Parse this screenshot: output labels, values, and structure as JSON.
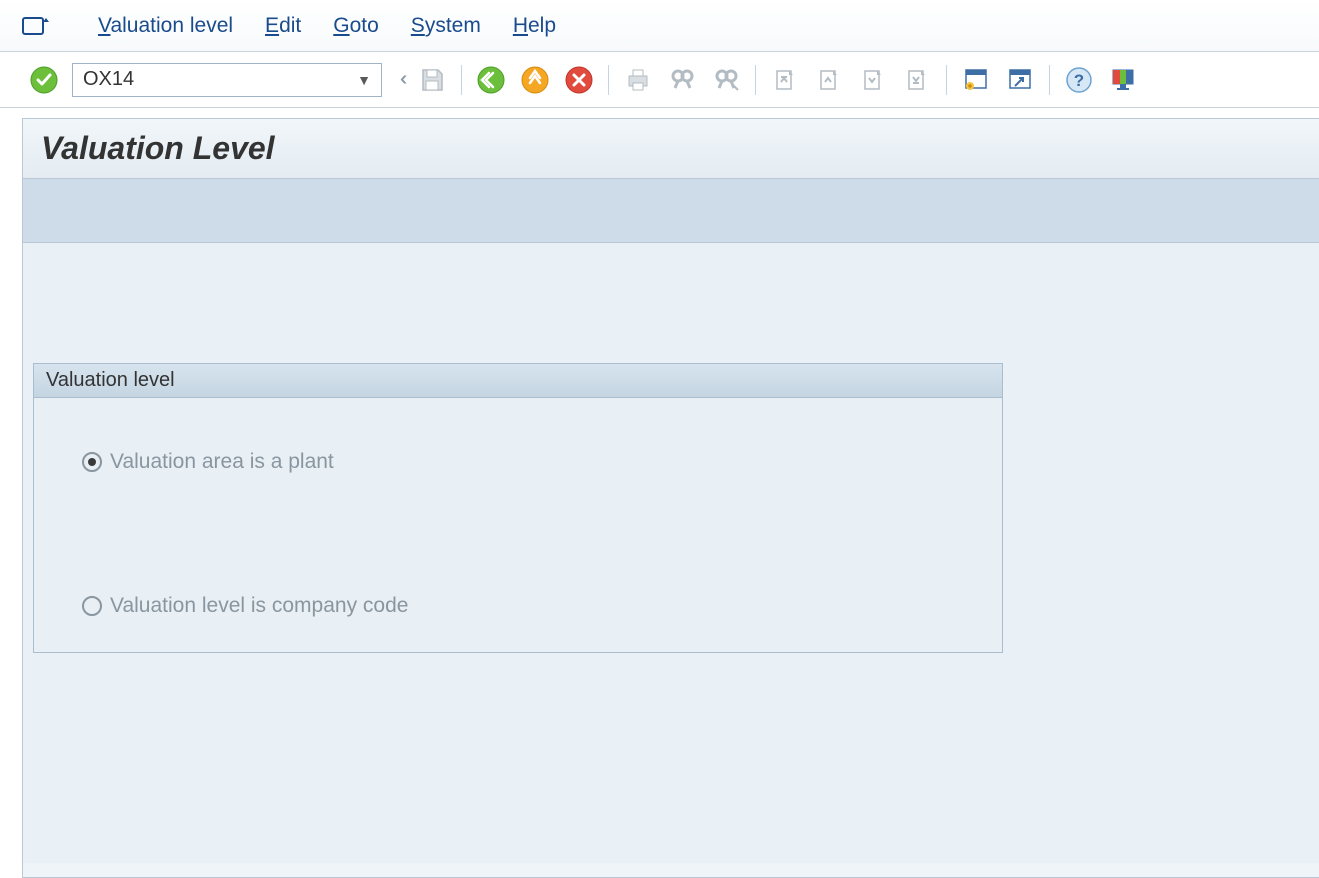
{
  "menu": {
    "items": [
      {
        "prefix": "V",
        "rest": "aluation level"
      },
      {
        "prefix": "E",
        "rest": "dit"
      },
      {
        "prefix": "G",
        "rest": "oto"
      },
      {
        "prefix": "S",
        "rest": "ystem"
      },
      {
        "prefix": "H",
        "rest": "elp"
      }
    ]
  },
  "toolbar": {
    "tcode": "OX14"
  },
  "page": {
    "title": "Valuation Level"
  },
  "group": {
    "title": "Valuation level",
    "options": [
      {
        "label": "Valuation area is a plant",
        "checked": true
      },
      {
        "label": "Valuation level is company code",
        "checked": false
      }
    ]
  }
}
